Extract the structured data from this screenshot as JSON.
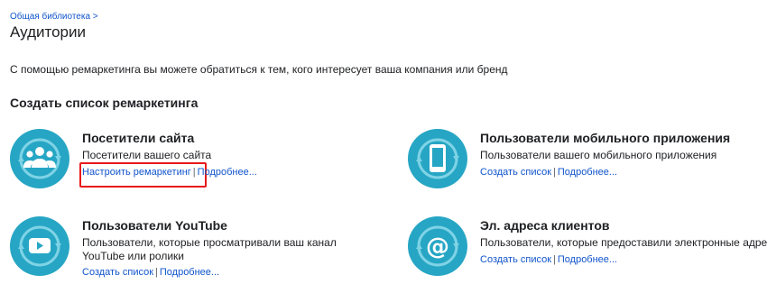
{
  "header": {
    "breadcrumb": "Общая библиотека >",
    "title": "Аудитории"
  },
  "intro": "С помощью ремаркетинга вы можете обратиться к тем, кого интересует ваша компания или бренд",
  "section_title": "Создать список ремаркетинга",
  "cards": [
    {
      "title": "Посетители сайта",
      "description": "Посетители вашего сайта",
      "primary_link": "Настроить ремаркетинг",
      "separator": "|",
      "secondary_link": "Подробнее...",
      "icon": "people-icon"
    },
    {
      "title": "Пользователи мобильного приложения",
      "description": "Пользователи вашего мобильного приложения",
      "primary_link": "Создать список",
      "separator": "|",
      "secondary_link": "Подробнее...",
      "icon": "mobile-phone-icon"
    },
    {
      "title": "Пользователи YouTube",
      "description": "Пользователи, которые просматривали ваш канал YouTube или ролики",
      "primary_link": "Создать список",
      "separator": "|",
      "secondary_link": "Подробнее...",
      "icon": "youtube-play-icon"
    },
    {
      "title": "Эл. адреса клиентов",
      "description": "Пользователи, которые предоставили электронные адреса",
      "primary_link": "Создать список",
      "separator": "|",
      "secondary_link": "Подробнее...",
      "icon": "email-at-icon"
    }
  ],
  "colors": {
    "icon_bg": "#26a6c4",
    "icon_ring": "#7fd3e6",
    "link": "#1155cc",
    "highlight": "#e81919"
  }
}
